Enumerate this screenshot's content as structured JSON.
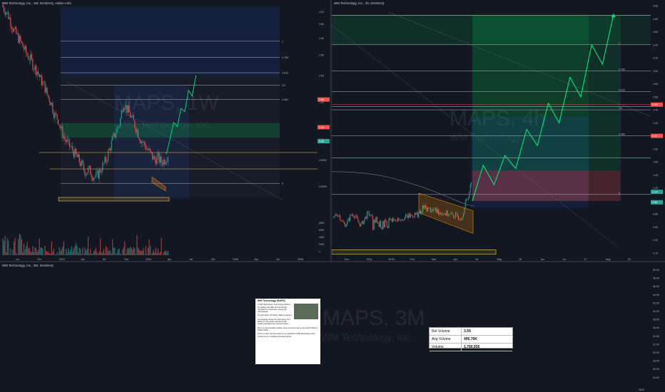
{
  "panes": {
    "left": {
      "header": "WM Technology, Inc., 1W, NASDAQ, Heikin Ashi",
      "watermark": "MAPS, 1W",
      "watermark_sub": "WM Technology, Inc."
    },
    "right": {
      "header": "WM Technology, Inc., 4h, NASDAQ",
      "watermark": "MAPS, 4h",
      "watermark_sub": "WM Technology, Inc."
    },
    "bottom": {
      "header": "WM Technology, Inc., 3M, NASDAQ",
      "watermark": "MAPS, 3M",
      "watermark_sub": "WM Technology, Inc."
    }
  },
  "info_card": {
    "title": "WM Technology (MAPS)",
    "p1": "1) WM Technology: Technology platform for leading cannabis and technology cannabis for consumers, using new technologies.",
    "p2": "The strengths: We likely realise a surge in",
    "p3": "Our analysis shows the chart going from Below 0.1 the same resistance with upside potential to the previous highs.",
    "p4": "We're a vast cannabis market, prices and price are on the watch before a bullish action.",
    "p5": "This is a chart and just ideas for our watchlist of WM Technology and it should not be considered financial advice."
  },
  "stats": [
    {
      "label": "Rel Volume",
      "value": "3.59"
    },
    {
      "label": "Avg Volume",
      "value": "495.76K"
    },
    {
      "label": "Volume",
      "value": "1,780,935"
    }
  ],
  "colors": {
    "up": "#26a69a",
    "down": "#ef5350",
    "projection": "#00e676",
    "target_zone": "#1b5e20",
    "stop_zone": "#8e1c1c",
    "fib": "#b2b5be",
    "yellow": "#f2c94c"
  },
  "chart_data": [
    {
      "type": "candlestick",
      "title": "",
      "xlabel": "",
      "ylabel": "",
      "x_ticks": [
        "Jul",
        "Oct",
        "2023",
        "Apr",
        "Jul",
        "Oct",
        "2024",
        "Apr",
        "Jul",
        "Oct",
        "2025",
        "Apr",
        "Jul",
        "2026"
      ],
      "y_ticks": [
        "4.00",
        "3.50",
        "3.00",
        "2.50",
        "2.00",
        "1.50",
        "1.00",
        "0.8000",
        "0.6000",
        "0.4000"
      ],
      "volume_ticks": [
        "80M",
        "60M",
        "40M",
        "20M",
        "0"
      ],
      "fib_levels": [
        {
          "level": "1",
          "price": 2.9
        },
        {
          "level": "0.786",
          "price": 2.43
        },
        {
          "level": "0.618",
          "price": 2.06
        },
        {
          "level": "0.5",
          "price": 1.8
        },
        {
          "level": "0.382",
          "price": 1.54
        },
        {
          "level": "0",
          "price": 0.62
        }
      ],
      "price_labels": [
        {
          "text": "1.54",
          "price": 1.54,
          "color": "#ef5350"
        },
        {
          "text": "1.14",
          "price": 1.14,
          "color": "#ef5350"
        },
        {
          "text": "0.98",
          "price": 0.98,
          "color": "#26a69a"
        }
      ],
      "weekly_close": [
        4.2,
        4.0,
        3.7,
        3.3,
        3.1,
        2.9,
        2.7,
        2.5,
        2.4,
        2.2,
        2.1,
        1.9,
        1.8,
        1.6,
        1.5,
        1.3,
        1.25,
        1.1,
        1.0,
        0.95,
        0.9,
        0.85,
        0.8,
        0.75,
        0.7,
        0.72,
        0.68,
        0.66,
        0.7,
        0.75,
        0.8,
        0.9,
        1.0,
        1.1,
        1.2,
        1.5,
        1.4,
        1.3,
        1.2,
        1.1,
        1.0,
        0.95,
        0.9,
        0.85,
        0.8,
        0.82,
        0.78,
        0.8,
        0.85
      ],
      "projection": [
        0.85,
        1.0,
        1.2,
        1.15,
        1.4,
        1.35,
        1.7,
        1.6,
        2.0
      ]
    },
    {
      "type": "candlestick",
      "title": "",
      "xlabel": "",
      "ylabel": "",
      "x_ticks": [
        "Dec",
        "2024",
        "15:30",
        "Feb",
        "Mar",
        "Apr",
        "16",
        "May",
        "16",
        "Jun",
        "Jul",
        "17",
        "Aug",
        "15"
      ],
      "y_ticks": [
        "4.00",
        "3.80",
        "3.60",
        "3.40",
        "3.20",
        "3.00",
        "2.80",
        "2.60",
        "2.40",
        "2.20",
        "2.00",
        "1.80",
        "1.60",
        "1.40",
        "1.20",
        "1.00",
        "0.80",
        "0.60",
        "0.40",
        "0.20"
      ],
      "fib_levels": [
        {
          "level": "1",
          "price": 3.4
        },
        {
          "level": "0.786",
          "price": 3.0
        },
        {
          "level": "0.618",
          "price": 2.68
        },
        {
          "level": "0.5",
          "price": 2.4
        },
        {
          "level": "0.382",
          "price": 2.0
        },
        {
          "level": "0",
          "price": 1.1
        }
      ],
      "price_labels": [
        {
          "text": "2.48",
          "price": 2.48,
          "color": "#ef5350"
        },
        {
          "text": "2.00",
          "price": 2.0,
          "color": "#ef5350"
        },
        {
          "text": "1.14",
          "price": 1.14,
          "color": "#26a69a"
        },
        {
          "text": "0.98",
          "price": 0.98,
          "color": "#26a69a"
        }
      ],
      "projection": [
        1.0,
        1.55,
        1.25,
        1.7,
        1.5,
        2.1,
        1.85,
        2.5,
        2.2,
        2.9,
        2.6,
        3.4,
        3.1,
        3.85
      ]
    },
    {
      "type": "candlestick",
      "title": "",
      "xlabel": "",
      "ylabel": "",
      "x_ticks": [
        "2022"
      ],
      "y_ticks": [
        "50.00",
        "48.00",
        "46.00",
        "44.00",
        "42.00",
        "40.00",
        "38.00",
        "36.00",
        "34.00",
        "32.00",
        "30.00",
        "28.00",
        "26.00",
        "24.00"
      ]
    }
  ]
}
